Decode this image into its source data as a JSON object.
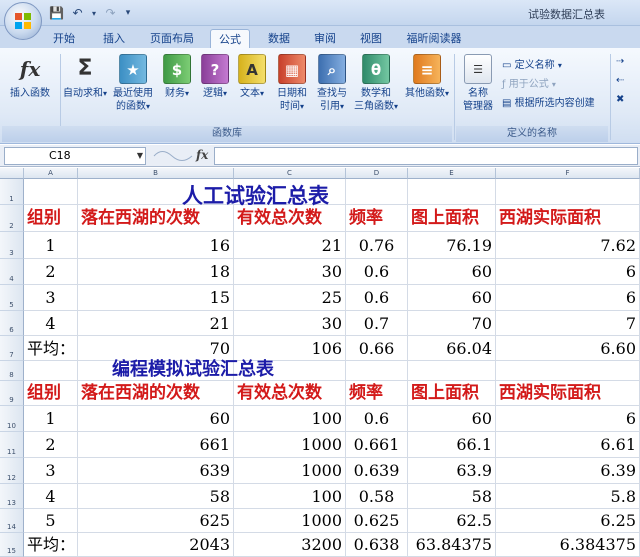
{
  "window": {
    "title": "试验数据汇总表"
  },
  "ribbon_tabs": [
    "开始",
    "插入",
    "页面布局",
    "公式",
    "数据",
    "审阅",
    "视图",
    "福昕阅读器"
  ],
  "active_tab": "公式",
  "ribbon": {
    "insert_function": "插入函数",
    "autosum": "自动求和",
    "recent": [
      "最近使用",
      "的函数"
    ],
    "financial": "财务",
    "logical": "逻辑",
    "text": "文本",
    "datetime": [
      "日期和",
      "时间"
    ],
    "lookup": [
      "查找与",
      "引用"
    ],
    "math": [
      "数学和",
      "三角函数"
    ],
    "more": "其他函数",
    "name_manager": [
      "名称",
      "管理器"
    ],
    "define_name": "定义名称",
    "use_in_formula": "用于公式",
    "create_from_selection": "根据所选内容创建",
    "group_function_library": "函数库",
    "group_defined_names": "定义的名称"
  },
  "formula_bar": {
    "name_box": "C18",
    "fx": "fx",
    "content": ""
  },
  "columns": [
    "A",
    "B",
    "C",
    "D",
    "E",
    "F"
  ],
  "rows": [
    "1",
    "2",
    "3",
    "4",
    "5",
    "6",
    "7",
    "8",
    "9",
    "10",
    "11",
    "12",
    "13",
    "14",
    "15"
  ],
  "sheet": {
    "title1": "人工试验汇总表",
    "title2": "编程模拟试验汇总表",
    "headers": [
      "组别",
      "落在西湖的次数",
      "有效总次数",
      "频率",
      "图上面积",
      "西湖实际面积"
    ],
    "table1": [
      [
        "1",
        "16",
        "21",
        "0.76",
        "76.19",
        "7.62"
      ],
      [
        "2",
        "18",
        "30",
        "0.6",
        "60",
        "6"
      ],
      [
        "3",
        "15",
        "25",
        "0.6",
        "60",
        "6"
      ],
      [
        "4",
        "21",
        "30",
        "0.7",
        "70",
        "7"
      ],
      [
        "平均：",
        "70",
        "106",
        "0.66",
        "66.04",
        "6.60"
      ]
    ],
    "table2": [
      [
        "1",
        "60",
        "100",
        "0.6",
        "60",
        "6"
      ],
      [
        "2",
        "661",
        "1000",
        "0.661",
        "66.1",
        "6.61"
      ],
      [
        "3",
        "639",
        "1000",
        "0.639",
        "63.9",
        "6.39"
      ],
      [
        "4",
        "58",
        "100",
        "0.58",
        "58",
        "5.8"
      ],
      [
        "5",
        "625",
        "1000",
        "0.625",
        "62.5",
        "6.25"
      ],
      [
        "平均：",
        "2043",
        "3200",
        "0.638",
        "63.84375",
        "6.384375"
      ]
    ]
  },
  "colors": {
    "title": "#1c1ca8",
    "header": "#d31a1a"
  }
}
